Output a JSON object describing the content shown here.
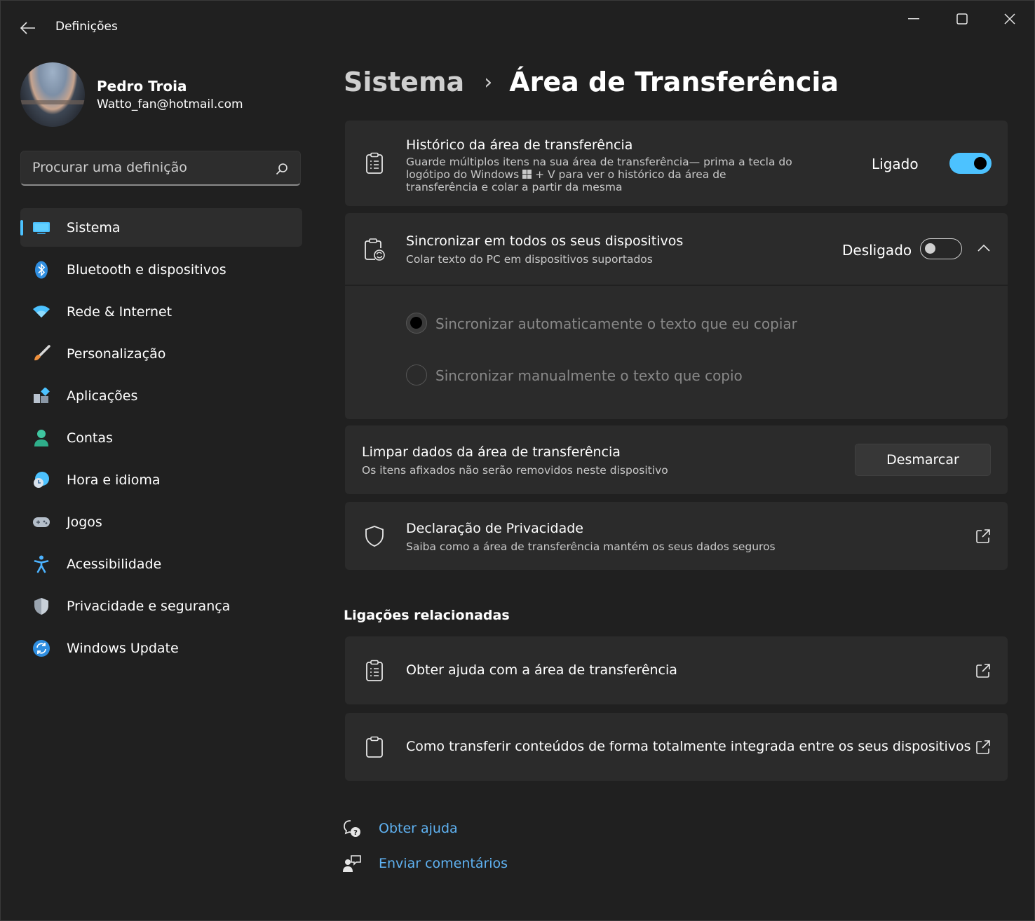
{
  "window": {
    "app_title": "Definições",
    "controls": {
      "minimize": "minimize-icon",
      "maximize": "maximize-icon",
      "close": "close-icon"
    }
  },
  "profile": {
    "name": "Pedro Troia",
    "email": "Watto_fan@hotmail.com"
  },
  "search": {
    "placeholder": "Procurar uma definição"
  },
  "sidebar": {
    "items": [
      {
        "label": "Sistema",
        "icon": "system-icon",
        "active": true
      },
      {
        "label": "Bluetooth e dispositivos",
        "icon": "bluetooth-icon"
      },
      {
        "label": "Rede & Internet",
        "icon": "wifi-icon"
      },
      {
        "label": "Personalização",
        "icon": "brush-icon"
      },
      {
        "label": "Aplicações",
        "icon": "apps-icon"
      },
      {
        "label": "Contas",
        "icon": "account-icon"
      },
      {
        "label": "Hora e idioma",
        "icon": "time-language-icon"
      },
      {
        "label": "Jogos",
        "icon": "gamepad-icon"
      },
      {
        "label": "Acessibilidade",
        "icon": "accessibility-icon"
      },
      {
        "label": "Privacidade e segurança",
        "icon": "shield-icon"
      },
      {
        "label": "Windows Update",
        "icon": "update-icon"
      }
    ]
  },
  "breadcrumb": {
    "parent": "Sistema",
    "separator": "›",
    "current": "Área de Transferência"
  },
  "history": {
    "title": "Histórico da área de transferência",
    "desc_line1": "Guarde múltiplos itens na sua área de transferência— prima a tecla do",
    "desc_line2_pre": "logótipo do Windows",
    "desc_line2_post": "+ V para ver o histórico da área de",
    "desc_line3": "transferência e colar a partir da mesma",
    "state_label": "Ligado",
    "on": true
  },
  "sync": {
    "title": "Sincronizar em todos os seus dispositivos",
    "desc": "Colar texto do PC em dispositivos suportados",
    "state_label": "Desligado",
    "on": false,
    "options": [
      {
        "label": "Sincronizar automaticamente o texto que eu copiar",
        "checked": true
      },
      {
        "label": "Sincronizar manualmente o texto que copio",
        "checked": false
      }
    ]
  },
  "clear": {
    "title": "Limpar dados da área de transferência",
    "desc": "Os itens afixados não serão removidos neste dispositivo",
    "button_label": "Desmarcar"
  },
  "privacy": {
    "title": "Declaração de Privacidade",
    "desc": "Saiba como a área de transferência mantém os seus dados seguros"
  },
  "related": {
    "title": "Ligações relacionadas",
    "links": [
      {
        "label": "Obter ajuda com a área de transferência"
      },
      {
        "label": "Como transferir conteúdos de forma totalmente integrada entre os seus dispositivos"
      }
    ]
  },
  "footer": {
    "help": "Obter ajuda",
    "feedback": "Enviar comentários"
  },
  "colors": {
    "accent": "#4cc2ff",
    "link": "#5fb2f2",
    "background": "#202020",
    "card": "#2b2b2b"
  }
}
